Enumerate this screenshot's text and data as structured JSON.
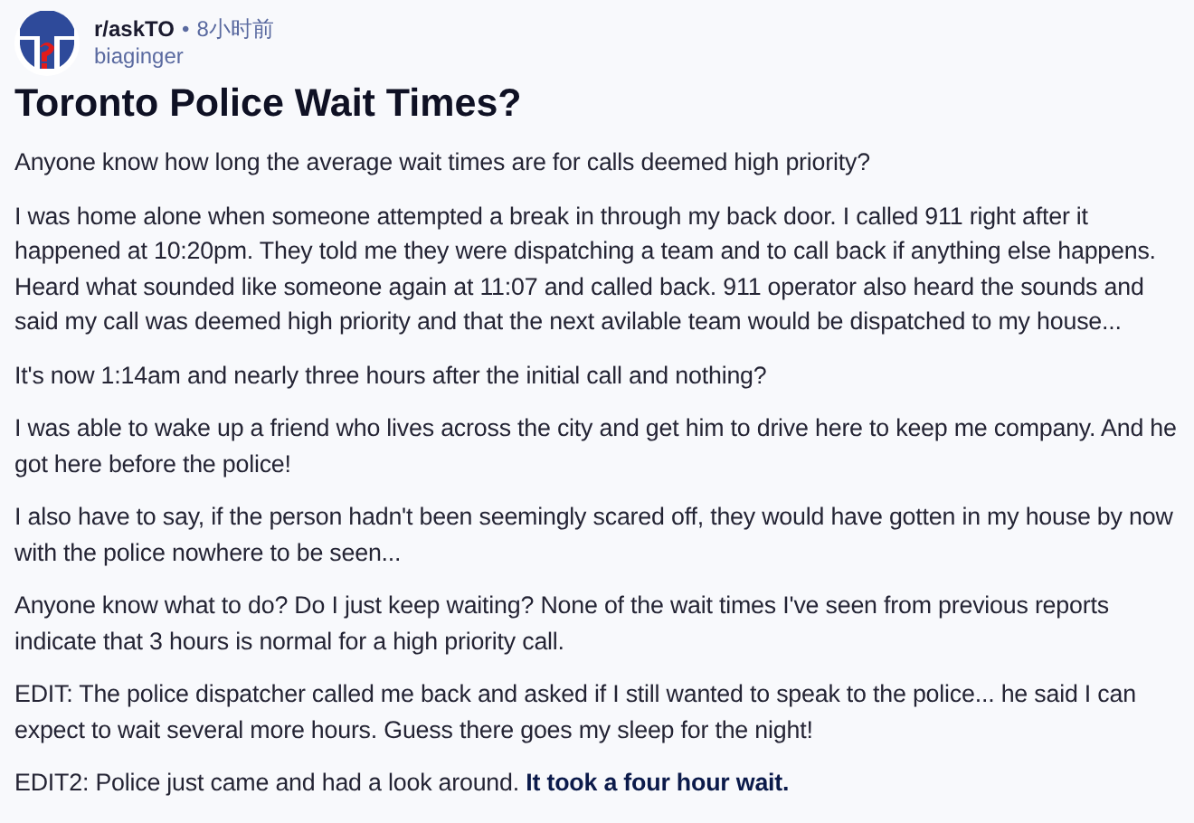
{
  "post": {
    "subreddit": "r/askTO",
    "separator": "•",
    "time": "8小时前",
    "author": "biaginger",
    "title": "Toronto Police Wait Times?",
    "paragraphs": [
      "Anyone know how long the average wait times are for calls deemed high priority?",
      "I was home alone when someone attempted a break in through my back door. I called 911 right after it happened at 10:20pm. They told me they were dispatching a team and to call back if anything else happens. Heard what sounded like someone again at 11:07 and called back. 911 operator also heard the sounds and said my call was deemed high priority and that the next avilable team would be dispatched to my house...",
      "It's now 1:14am and nearly three hours after the initial call and nothing?",
      "I was able to wake up a friend who lives across the city and get him to drive here to keep me company. And he got here before the police!",
      "I also have to say, if the person hadn't been seemingly scared off, they would have gotten in my house by now with the police nowhere to be seen...",
      "Anyone know what to do? Do I just keep waiting? None of the wait times I've seen from previous reports indicate that 3 hours is normal for a high priority call.",
      "EDIT: The police dispatcher called me back and asked if I still wanted to speak to the police... he said I can expect to wait several more hours. Guess there goes my sleep for the night!",
      "EDIT2: Police just came and had a look around. **It took a four hour wait.**"
    ]
  }
}
